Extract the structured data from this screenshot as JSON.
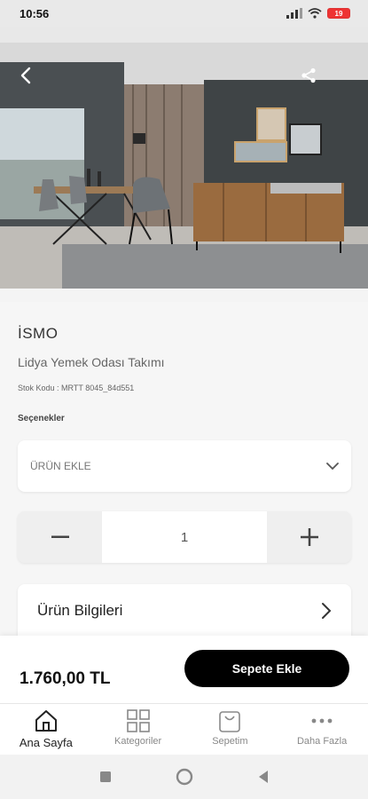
{
  "status_bar": {
    "time": "10:56",
    "battery": "19"
  },
  "product": {
    "brand": "İSMO",
    "name": "Lidya Yemek Odası Takımı",
    "sku": "Stok Kodu : MRTT 8045_84d551",
    "options_label": "Seçenekler",
    "select_placeholder": "ÜRÜN EKLE",
    "quantity": "1",
    "info_label": "Ürün Bilgileri",
    "price": "1.760,00 TL"
  },
  "actions": {
    "add_to_cart": "Sepete Ekle"
  },
  "tabbar": {
    "items": [
      {
        "label": "Ana Sayfa",
        "icon": "home-icon"
      },
      {
        "label": "Kategoriler",
        "icon": "grid-icon"
      },
      {
        "label": "Sepetim",
        "icon": "bag-icon"
      },
      {
        "label": "Daha Fazla",
        "icon": "more-icon"
      }
    ]
  },
  "colors": {
    "primary": "#000000",
    "background": "#f6f6f6",
    "battery": "#e33333"
  }
}
